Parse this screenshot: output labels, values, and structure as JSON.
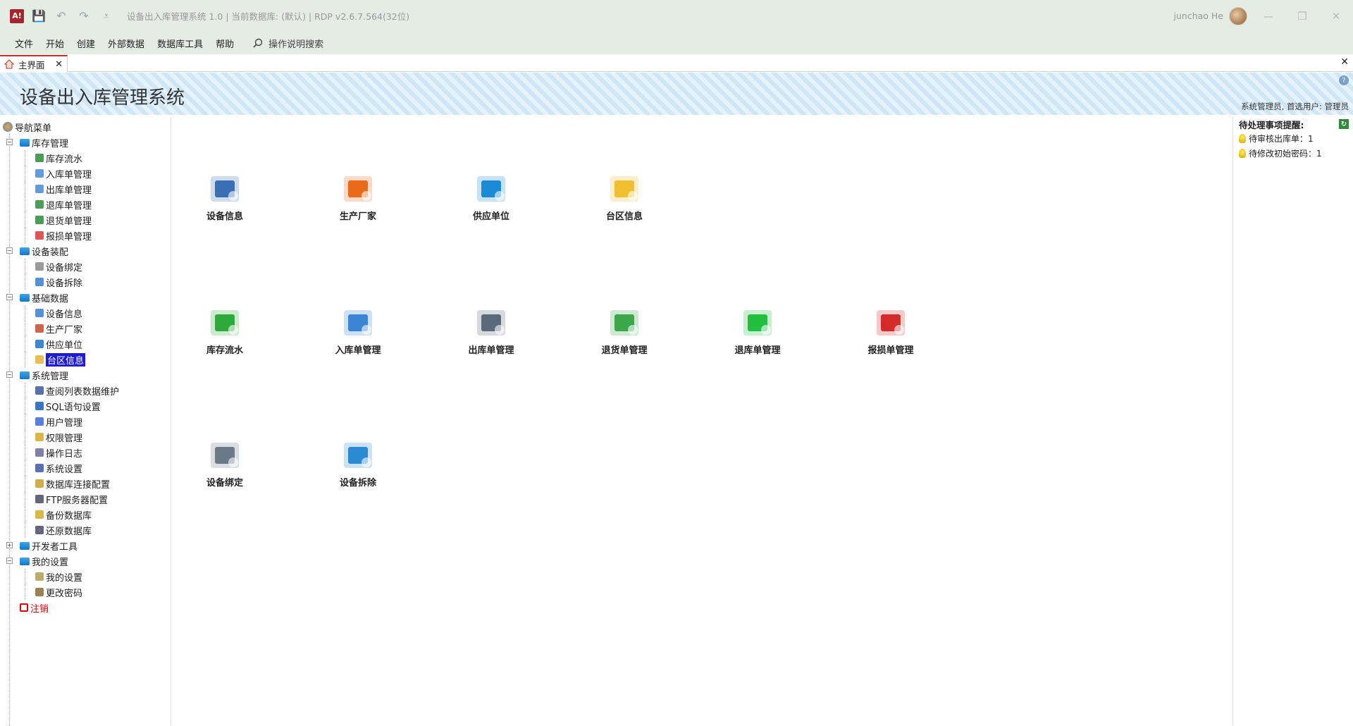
{
  "window": {
    "title": "设备出入库管理系统 1.0 | 当前数据库: (默认) | RDP v2.6.7.564(32位)",
    "user": "junchao He",
    "app_icon": "A!"
  },
  "menu": [
    "文件",
    "开始",
    "创建",
    "外部数据",
    "数据库工具",
    "帮助"
  ],
  "search_label": "操作说明搜索",
  "tab": {
    "label": "主界面"
  },
  "banner": {
    "title": "设备出入库管理系统",
    "userinfo": "系统管理员, 首选用户: 管理员",
    "help": "?"
  },
  "nav": {
    "root": "导航菜单",
    "groups": [
      {
        "label": "库存管理",
        "items": [
          "库存流水",
          "入库单管理",
          "出库单管理",
          "退库单管理",
          "退货单管理",
          "报损单管理"
        ]
      },
      {
        "label": "设备装配",
        "items": [
          "设备绑定",
          "设备拆除"
        ]
      },
      {
        "label": "基础数据",
        "items": [
          "设备信息",
          "生产厂家",
          "供应单位",
          "台区信息"
        ]
      },
      {
        "label": "系统管理",
        "items": [
          "查阅列表数据维护",
          "SQL语句设置",
          "用户管理",
          "权限管理",
          "操作日志",
          "系统设置",
          "数据库连接配置",
          "FTP服务器配置",
          "备份数据库",
          "还原数据库"
        ]
      },
      {
        "label": "开发者工具",
        "items": []
      },
      {
        "label": "我的设置",
        "items": [
          "我的设置",
          "更改密码"
        ]
      }
    ],
    "logout": "注销"
  },
  "tiles": {
    "row1": [
      "设备信息",
      "生产厂家",
      "供应单位",
      "台区信息"
    ],
    "row2": [
      "库存流水",
      "入库单管理",
      "出库单管理",
      "退货单管理",
      "退库单管理",
      "报损单管理"
    ],
    "row3": [
      "设备绑定",
      "设备拆除"
    ]
  },
  "reminder": {
    "title": "待处理事项提醒:",
    "items": [
      "待审核出库单：1",
      "待修改初始密码：1"
    ]
  }
}
